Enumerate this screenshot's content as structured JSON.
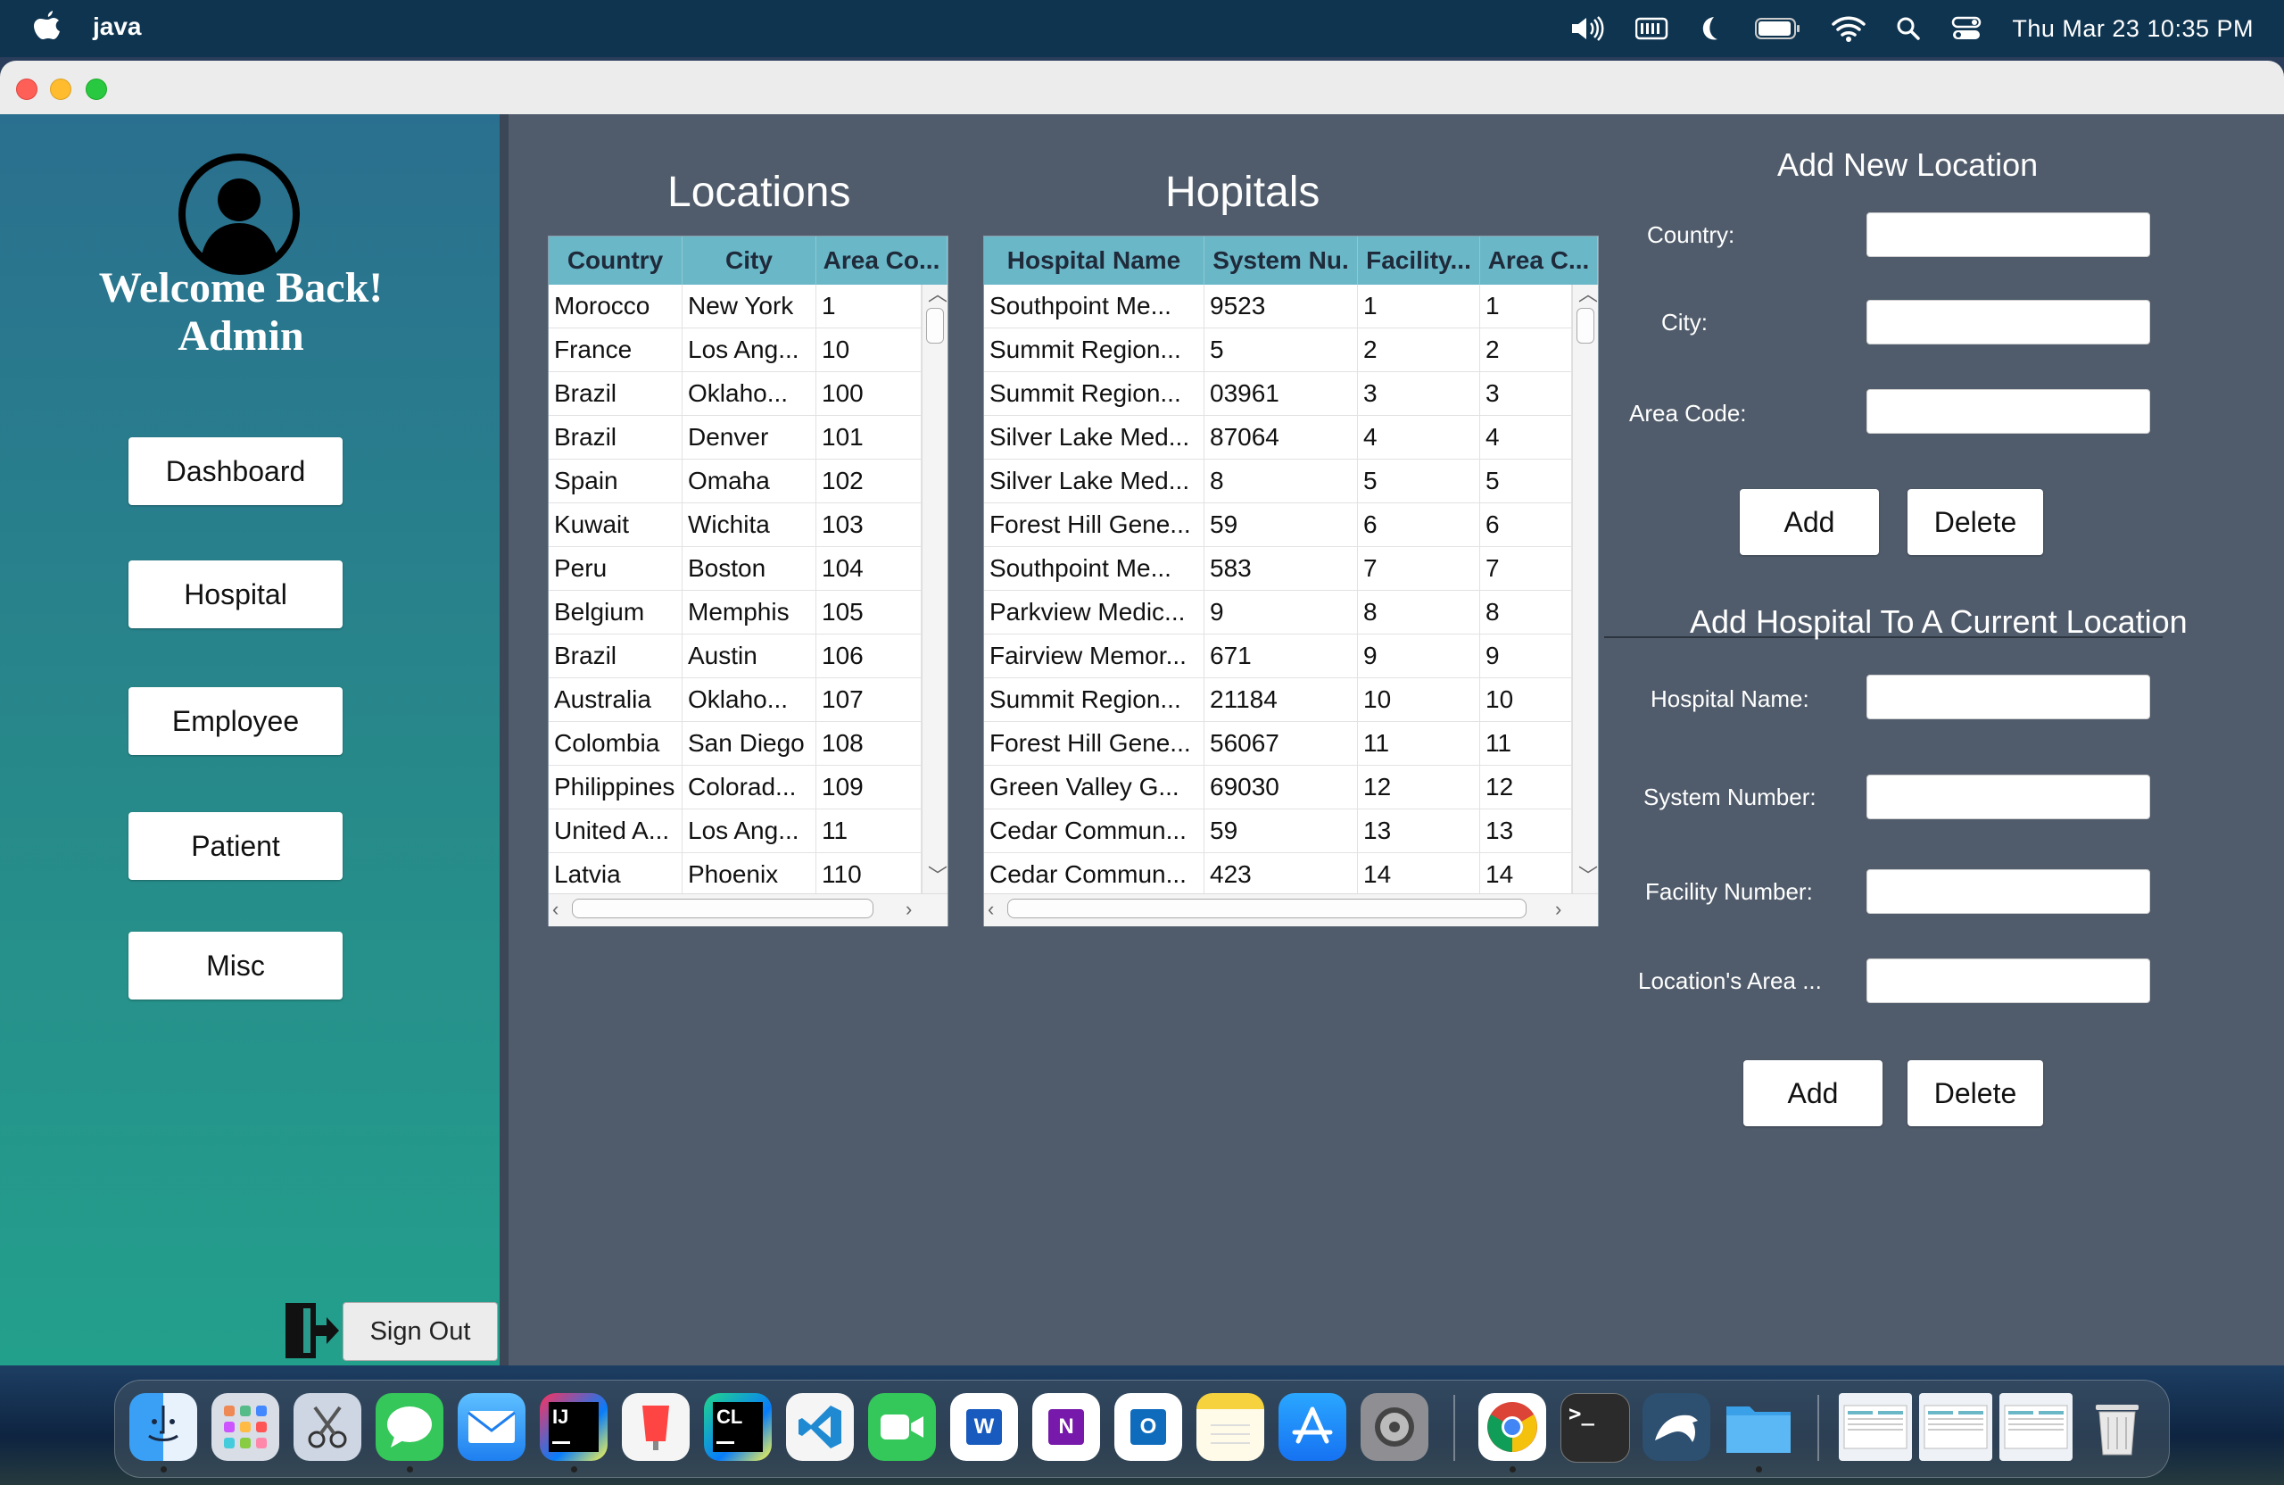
{
  "menubar": {
    "app_name": "java",
    "clock": "Thu Mar 23  10:35 PM",
    "icons": [
      "apple-icon",
      "volume-icon",
      "battery-menu-icon",
      "moon-icon",
      "battery-icon",
      "wifi-icon",
      "search-icon",
      "control-center-icon"
    ]
  },
  "sidebar": {
    "welcome_line1": "Welcome Back!",
    "welcome_line2": "Admin",
    "nav": {
      "dashboard": "Dashboard",
      "hospital": "Hospital",
      "employee": "Employee",
      "patient": "Patient",
      "misc": "Misc"
    },
    "sign_out": "Sign Out"
  },
  "locations": {
    "title": "Locations",
    "columns": [
      "Country",
      "City",
      "Area Co..."
    ],
    "rows": [
      [
        "Morocco",
        "New York",
        "1"
      ],
      [
        "France",
        "Los Ang...",
        "10"
      ],
      [
        "Brazil",
        "Oklaho...",
        "100"
      ],
      [
        "Brazil",
        "Denver",
        "101"
      ],
      [
        "Spain",
        "Omaha",
        "102"
      ],
      [
        "Kuwait",
        "Wichita",
        "103"
      ],
      [
        "Peru",
        "Boston",
        "104"
      ],
      [
        "Belgium",
        "Memphis",
        "105"
      ],
      [
        "Brazil",
        "Austin",
        "106"
      ],
      [
        "Australia",
        "Oklaho...",
        "107"
      ],
      [
        "Colombia",
        "San Diego",
        "108"
      ],
      [
        "Philippines",
        "Colorad...",
        "109"
      ],
      [
        "United A...",
        "Los Ang...",
        "11"
      ],
      [
        "Latvia",
        "Phoenix",
        "110"
      ]
    ]
  },
  "hospitals": {
    "title": "Hopitals",
    "columns": [
      "Hospital Name",
      "System Nu.",
      "Facility...",
      "Area C..."
    ],
    "rows": [
      [
        "Southpoint Me...",
        "9523",
        "1",
        "1"
      ],
      [
        "Summit Region...",
        "5",
        "2",
        "2"
      ],
      [
        "Summit Region...",
        "03961",
        "3",
        "3"
      ],
      [
        "Silver Lake Med...",
        "87064",
        "4",
        "4"
      ],
      [
        "Silver Lake Med...",
        "8",
        "5",
        "5"
      ],
      [
        "Forest Hill Gene...",
        "59",
        "6",
        "6"
      ],
      [
        "Southpoint Me...",
        "583",
        "7",
        "7"
      ],
      [
        "Parkview Medic...",
        "9",
        "8",
        "8"
      ],
      [
        "Fairview Memor...",
        "671",
        "9",
        "9"
      ],
      [
        "Summit Region...",
        "21184",
        "10",
        "10"
      ],
      [
        "Forest Hill Gene...",
        "56067",
        "11",
        "11"
      ],
      [
        "Green Valley G...",
        "69030",
        "12",
        "12"
      ],
      [
        "Cedar Commun...",
        "59",
        "13",
        "13"
      ],
      [
        "Cedar Commun...",
        "423",
        "14",
        "14"
      ]
    ]
  },
  "add_location": {
    "title": "Add New Location",
    "country_label": "Country:",
    "city_label": "City:",
    "area_code_label": "Area Code:",
    "country_value": "",
    "city_value": "",
    "area_code_value": "",
    "add": "Add",
    "delete": "Delete"
  },
  "add_hospital": {
    "title": "Add Hospital To A Current Location",
    "name_label": "Hospital Name:",
    "system_label": "System Number:",
    "facility_label": "Facility Number:",
    "area_label": "Location's Area ...",
    "name_value": "",
    "system_value": "",
    "facility_value": "",
    "area_value": "",
    "add": "Add",
    "delete": "Delete"
  },
  "dock": {
    "apps": [
      "Finder",
      "Launchpad",
      "Screenshot",
      "Messages",
      "Mail",
      "IntelliJ IDEA",
      "Keynote",
      "CLion",
      "Visual Studio Code",
      "FaceTime",
      "Word",
      "OneNote",
      "Outlook",
      "Notes",
      "App Store",
      "System Settings",
      "Chrome",
      "Terminal",
      "MySQL Workbench",
      "Folder",
      "Window 1",
      "Window 2",
      "Window 3",
      "Trash"
    ]
  }
}
